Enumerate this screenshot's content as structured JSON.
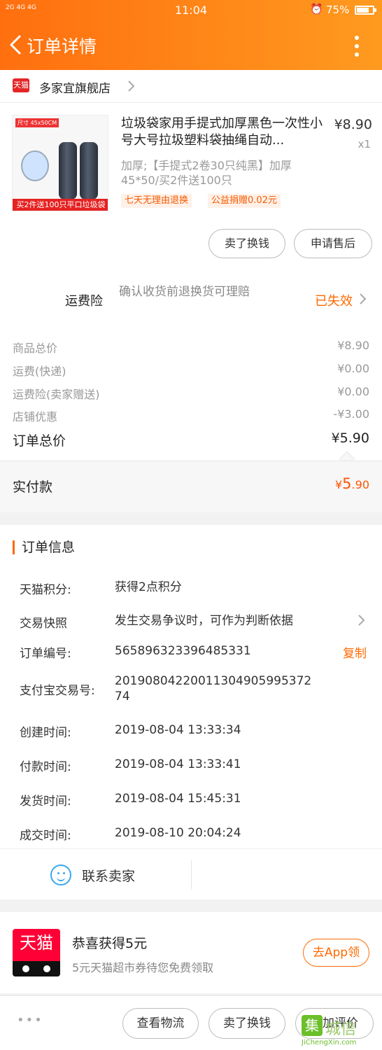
{
  "status_bar": {
    "signal": "2G 4G 4G",
    "time": "11:04",
    "battery": "75%",
    "battery_level": 0.75
  },
  "nav": {
    "title": "订单详情"
  },
  "shop": {
    "badge": "天猫",
    "name": "多家宜旗舰店"
  },
  "product": {
    "image_note": "尺寸 45x50CM",
    "image_banner": "买2件送100只平口垃圾袋",
    "title": "垃圾袋家用手提式加厚黑色一次性小号大号拉圾塑料袋抽绳自动...",
    "price": "¥8.90",
    "quantity": "x1",
    "spec": "加厚;【手提式2卷30只纯黑】加厚45*50/买2件送100只",
    "tags": [
      "七天无理由退换",
      "公益捐赠0.02元"
    ],
    "buttons": [
      "卖了换钱",
      "申请售后"
    ]
  },
  "insurance": {
    "label": "运费险",
    "desc": "确认收货前退换货可理赔",
    "status": "已失效"
  },
  "fees": {
    "rows": [
      {
        "label": "商品总价",
        "value": "¥8.90"
      },
      {
        "label": "运费(快递)",
        "value": "¥0.00"
      },
      {
        "label": "运费险(卖家赠送)",
        "value": "¥0.00"
      },
      {
        "label": "店铺优惠",
        "value": "-¥3.00"
      }
    ],
    "total_label": "订单总价",
    "total_value": "¥5.90"
  },
  "paid": {
    "label": "实付款",
    "currency": "¥",
    "amount_int": "5",
    "amount_dec": ".90"
  },
  "order_info": {
    "heading": "订单信息",
    "rows": [
      {
        "key": "天猫积分:",
        "value": "获得2点积分"
      },
      {
        "key": "交易快照",
        "value": "发生交易争议时，可作为判断依据"
      },
      {
        "key": "订单编号:",
        "value": "565896323396485331"
      },
      {
        "key": "支付宝交易号:",
        "value": "2019080422001130490599537274"
      },
      {
        "key": "创建时间:",
        "value": "2019-08-04 13:33:34"
      },
      {
        "key": "付款时间:",
        "value": "2019-08-04 13:33:41"
      },
      {
        "key": "发货时间:",
        "value": "2019-08-04 15:45:31"
      },
      {
        "key": "成交时间:",
        "value": "2019-08-10 20:04:24"
      }
    ],
    "copy_label": "复制",
    "contact_label": "联系卖家"
  },
  "promo": {
    "logo": "天猫",
    "title": "恭喜获得5元",
    "subtitle": "5元天猫超市券待您免费领取",
    "button": "去App领"
  },
  "bottom_bar": {
    "more": "•••",
    "buttons": [
      "查看物流",
      "卖了换钱",
      "追加评价"
    ]
  },
  "watermark": {
    "mark": "集",
    "text": "城信",
    "url": "JiChengXin.com"
  },
  "colors": {
    "accent": "#ff6a00",
    "header_start": "#ff6f0f",
    "header_end": "#ff9a1f",
    "tmall_red": "#ff0036"
  }
}
